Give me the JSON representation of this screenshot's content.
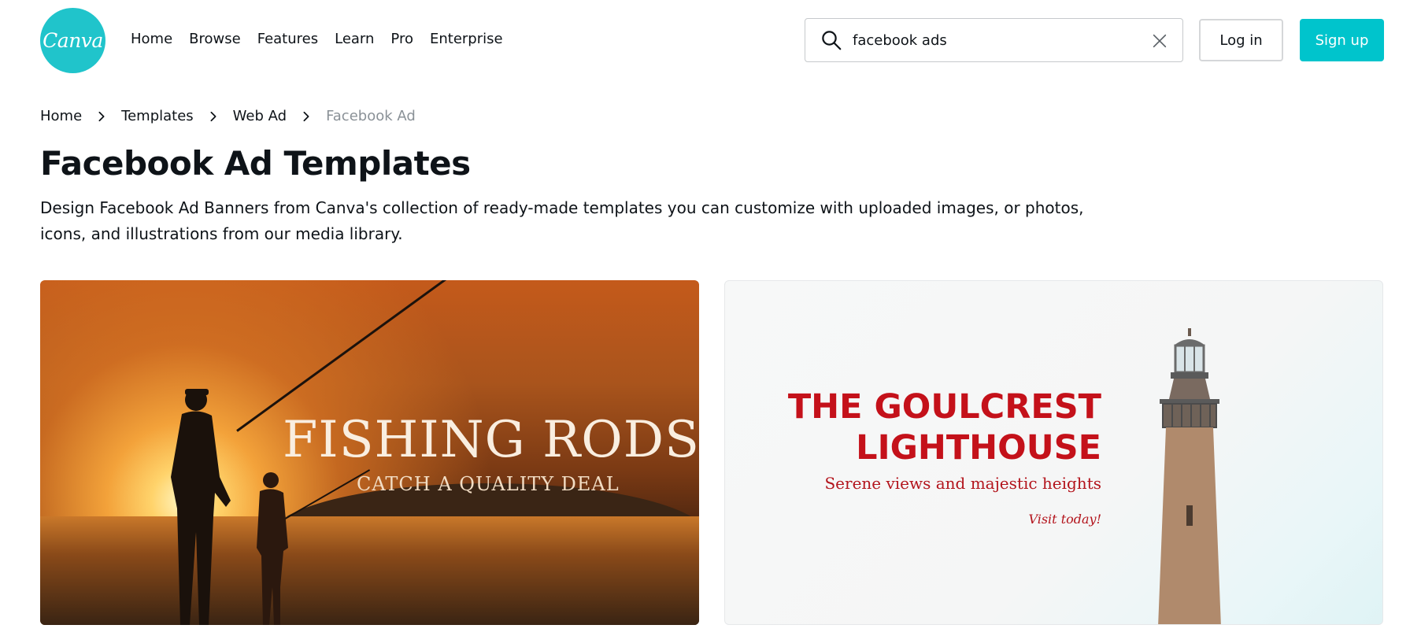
{
  "header": {
    "logo_text": "Canva",
    "nav": [
      "Home",
      "Browse",
      "Features",
      "Learn",
      "Pro",
      "Enterprise"
    ],
    "search_value": "facebook ads",
    "login_label": "Log in",
    "signup_label": "Sign up"
  },
  "breadcrumb": {
    "items": [
      "Home",
      "Templates",
      "Web Ad",
      "Facebook Ad"
    ]
  },
  "page": {
    "title": "Facebook Ad Templates",
    "description": "Design Facebook Ad Banners from Canva's collection of ready-made templates you can customize with uploaded images, or photos, icons, and illustrations from our media library."
  },
  "templates": [
    {
      "headline": "FISHING RODS",
      "subline": "CATCH A QUALITY DEAL"
    },
    {
      "headline_line1": "THE GOULCREST",
      "headline_line2": "LIGHTHOUSE",
      "subline": "Serene views and majestic heights",
      "cta": "Visit today!"
    }
  ],
  "colors": {
    "brand": "#00c4cc",
    "lighthouse_red": "#c4111a"
  },
  "icons": {
    "search": "search-icon",
    "clear": "close-icon",
    "breadcrumb_separator": "chevron-right-icon"
  }
}
